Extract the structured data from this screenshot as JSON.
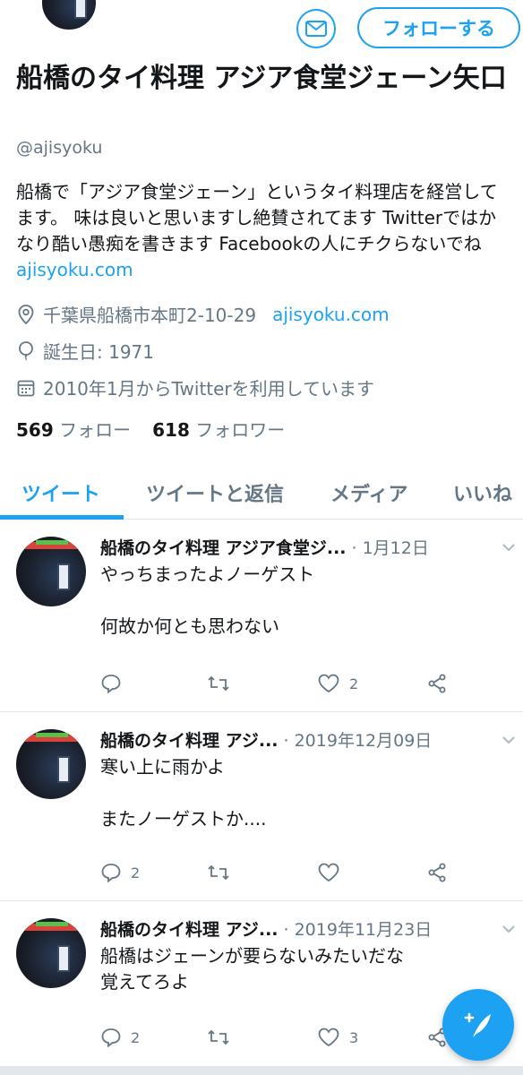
{
  "profile": {
    "follow_label": "フォローする",
    "name": "船橋のタイ料理 アジア食堂ジェーン矢口",
    "handle": "@ajisyoku",
    "bio": "船橋で「アジア食堂ジェーン」というタイ料理店を経営してます。 味は良いと思いますし絶賛されてます Twitterではかなり酷い愚痴を書きます Facebookの人にチクらないでね ",
    "bio_link": "ajisyoku.com",
    "location": "千葉県船橋市本町2-10-29",
    "website": "ajisyoku.com",
    "birthday": "誕生日: 1971",
    "joined": "2010年1月からTwitterを利用しています",
    "following_count": "569",
    "following_label": "フォロー",
    "followers_count": "618",
    "followers_label": "フォロワー"
  },
  "tabs": [
    {
      "label": "ツイート",
      "active": true
    },
    {
      "label": "ツイートと返信",
      "active": false
    },
    {
      "label": "メディア",
      "active": false
    },
    {
      "label": "いいね",
      "active": false
    }
  ],
  "tweets": [
    {
      "author": "船橋のタイ料理 アジア食堂ジ...",
      "date": "· 1月12日",
      "text": "やっちまったよノーゲスト\n\n何故か何とも思わない",
      "reply_count": "",
      "retweet_count": "",
      "like_count": "2"
    },
    {
      "author": "船橋のタイ料理 アジ...",
      "date": "· 2019年12月09日",
      "text": "寒い上に雨かよ\n\nまたノーゲストか....",
      "reply_count": "2",
      "retweet_count": "",
      "like_count": ""
    },
    {
      "author": "船橋のタイ料理 アジ...",
      "date": "· 2019年11月23日",
      "text": "船橋はジェーンが要らないみたいだな\n覚えてろよ",
      "reply_count": "2",
      "retweet_count": "",
      "like_count": "3"
    }
  ],
  "colors": {
    "accent": "#1da1f2",
    "secondary_text": "#657786",
    "primary_text": "#14171a"
  },
  "icons": [
    "mail-icon",
    "location-icon",
    "balloon-icon",
    "calendar-icon",
    "reply-icon",
    "retweet-icon",
    "like-icon",
    "share-icon",
    "chevron-down-icon",
    "compose-icon"
  ]
}
